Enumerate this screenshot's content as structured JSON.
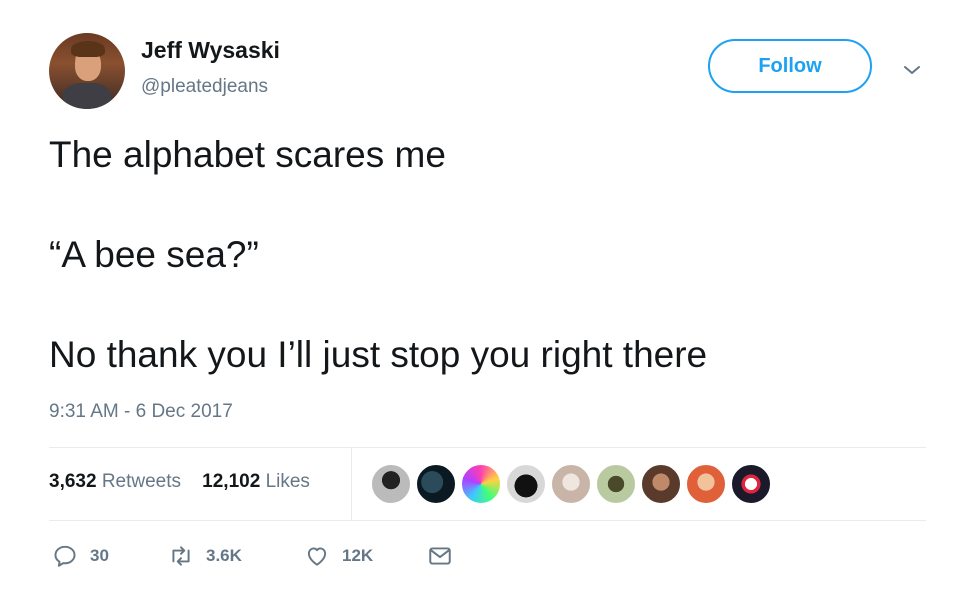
{
  "author": {
    "name": "Jeff Wysaski",
    "handle": "@pleatedjeans"
  },
  "header": {
    "follow_label": "Follow"
  },
  "tweet": {
    "lines": [
      "The alphabet scares me",
      "“A bee sea?”",
      "No thank you I’ll just stop you right there"
    ],
    "timestamp": "9:31 AM - 6 Dec 2017"
  },
  "stats": {
    "retweets_count": "3,632",
    "retweets_label": "Retweets",
    "likes_count": "12,102",
    "likes_label": "Likes"
  },
  "actions": {
    "replies": "30",
    "retweets": "3.6K",
    "likes": "12K"
  },
  "colors": {
    "accent": "#1da1f2",
    "secondary_text": "#657786",
    "divider": "#e6ecf0"
  }
}
